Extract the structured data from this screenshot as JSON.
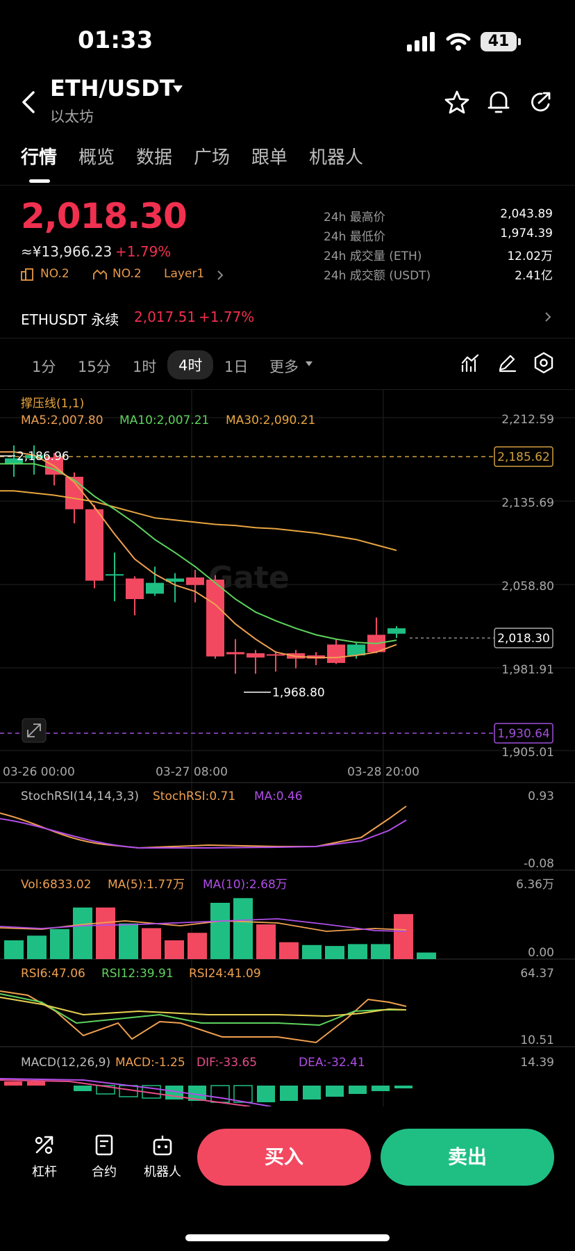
{
  "status_bar": {
    "time": "01:33",
    "battery": "41"
  },
  "header": {
    "pair": "ETH/USDT",
    "name": "以太坊"
  },
  "tabs": [
    "行情",
    "概览",
    "数据",
    "广场",
    "跟单",
    "机器人"
  ],
  "ticker": {
    "price": "2,018.30",
    "cny": "≈¥13,966.23",
    "change": "+1.79%",
    "rank1": "NO.2",
    "rank2": "NO.2",
    "sector": "Layer1",
    "stats": [
      {
        "label": "24h 最高价",
        "value": "2,043.89"
      },
      {
        "label": "24h 最低价",
        "value": "1,974.39"
      },
      {
        "label": "24h 成交量 (ETH)",
        "value": "12.02万"
      },
      {
        "label": "24h 成交额 (USDT)",
        "value": "2.41亿"
      }
    ]
  },
  "perpetual": {
    "label": "ETHUSDT 永续",
    "price": "2,017.51",
    "change": "+1.77%"
  },
  "timeframes": {
    "items": [
      "1分",
      "15分",
      "1时",
      "4时",
      "1日"
    ],
    "more": "更多"
  },
  "main_chart": {
    "indicator": "撑压线(1,1)",
    "ma5": "MA5:2,007.80",
    "ma10": "MA10:2,007.21",
    "ma30": "MA30:2,090.21",
    "y_ticks": [
      "2,212.59",
      "2,135.69",
      "2,058.80",
      "1,981.91",
      "1,905.01"
    ],
    "resistance": "2,185.62",
    "support": "1,930.64",
    "current": "2,018.30",
    "high_label": "2,186.96",
    "low_label": "1,968.80",
    "x_labels": [
      "03-26 00:00",
      "03-27 08:00",
      "03-28 20:00"
    ],
    "watermark": "Gate"
  },
  "stochrsi": {
    "label": "StochRSI(14,14,3,3)",
    "value": "StochRSI:0.71",
    "ma": "MA:0.46",
    "top": "0.93",
    "bottom": "-0.08"
  },
  "volume": {
    "vol": "Vol:6833.02",
    "ma5": "MA(5):1.77万",
    "ma10": "MA(10):2.68万",
    "top": "6.36万",
    "bottom": "0.00"
  },
  "rsi": {
    "rsi6": "RSI6:47.06",
    "rsi12": "RSI12:39.91",
    "rsi24": "RSI24:41.09",
    "top": "64.37",
    "bottom": "10.51"
  },
  "macd": {
    "label": "MACD(12,26,9)",
    "macd": "MACD:-1.25",
    "dif": "DIF:-33.65",
    "dea": "DEA:-32.41",
    "top": "14.39"
  },
  "bottom_nav": {
    "leverage": "杠杆",
    "contract": "合约",
    "bot": "机器人",
    "buy": "买入",
    "sell": "卖出"
  },
  "colors": {
    "up": "#1fbf84",
    "down": "#f24961",
    "ma5": "#f0a050",
    "ma10": "#5ed35e",
    "ma30": "#e8a640",
    "purple": "#b04ee8"
  },
  "chart_data": {
    "type": "candlestick",
    "candles": [
      {
        "o": 2170,
        "h": 2187,
        "l": 2158,
        "c": 2175
      },
      {
        "o": 2175,
        "h": 2187,
        "l": 2160,
        "c": 2178
      },
      {
        "o": 2176,
        "h": 2180,
        "l": 2150,
        "c": 2160
      },
      {
        "o": 2158,
        "h": 2162,
        "l": 2115,
        "c": 2128
      },
      {
        "o": 2128,
        "h": 2132,
        "l": 2055,
        "c": 2062
      },
      {
        "o": 2068,
        "h": 2088,
        "l": 2043,
        "c": 2068
      },
      {
        "o": 2064,
        "h": 2066,
        "l": 2030,
        "c": 2045
      },
      {
        "o": 2050,
        "h": 2075,
        "l": 2048,
        "c": 2060
      },
      {
        "o": 2061,
        "h": 2069,
        "l": 2042,
        "c": 2064
      },
      {
        "o": 2065,
        "h": 2072,
        "l": 2042,
        "c": 2058
      },
      {
        "o": 2063,
        "h": 2067,
        "l": 1990,
        "c": 1992
      },
      {
        "o": 1996,
        "h": 2008,
        "l": 1976,
        "c": 1994
      },
      {
        "o": 1995,
        "h": 1998,
        "l": 1976,
        "c": 1991
      },
      {
        "o": 1994,
        "h": 1997,
        "l": 1978,
        "c": 1993
      },
      {
        "o": 1995,
        "h": 1998,
        "l": 1981,
        "c": 1990
      },
      {
        "o": 1993,
        "h": 1996,
        "l": 1984,
        "c": 1990
      },
      {
        "o": 2003,
        "h": 2008,
        "l": 1985,
        "c": 1986
      },
      {
        "o": 1993,
        "h": 2005,
        "l": 1990,
        "c": 2003
      },
      {
        "o": 2012,
        "h": 2028,
        "l": 1995,
        "c": 1996
      },
      {
        "o": 2013,
        "h": 2020,
        "l": 2009,
        "c": 2018
      }
    ],
    "ma5": [
      2181,
      2178,
      2168,
      2153,
      2130,
      2105,
      2082,
      2068,
      2058,
      2052,
      2040,
      2022,
      2008,
      1996,
      1992,
      1991,
      1991,
      1993,
      1996,
      2003
    ],
    "ma10": [
      2170,
      2170,
      2165,
      2155,
      2140,
      2128,
      2115,
      2100,
      2088,
      2075,
      2060,
      2045,
      2033,
      2025,
      2018,
      2012,
      2008,
      2005,
      2004,
      2007
    ],
    "ma30": [
      2145,
      2143,
      2141,
      2138,
      2135,
      2130,
      2125,
      2120,
      2118,
      2116,
      2114,
      2113,
      2111,
      2110,
      2108,
      2106,
      2103,
      2100,
      2095,
      2090
    ],
    "volume": [
      20,
      25,
      32,
      55,
      55,
      38,
      33,
      20,
      28,
      60,
      65,
      37,
      18,
      15,
      14,
      16,
      16,
      48,
      7
    ],
    "volume_up": [
      true,
      true,
      true,
      true,
      false,
      true,
      false,
      false,
      false,
      true,
      true,
      false,
      false,
      true,
      true,
      true,
      true,
      false,
      true
    ]
  }
}
